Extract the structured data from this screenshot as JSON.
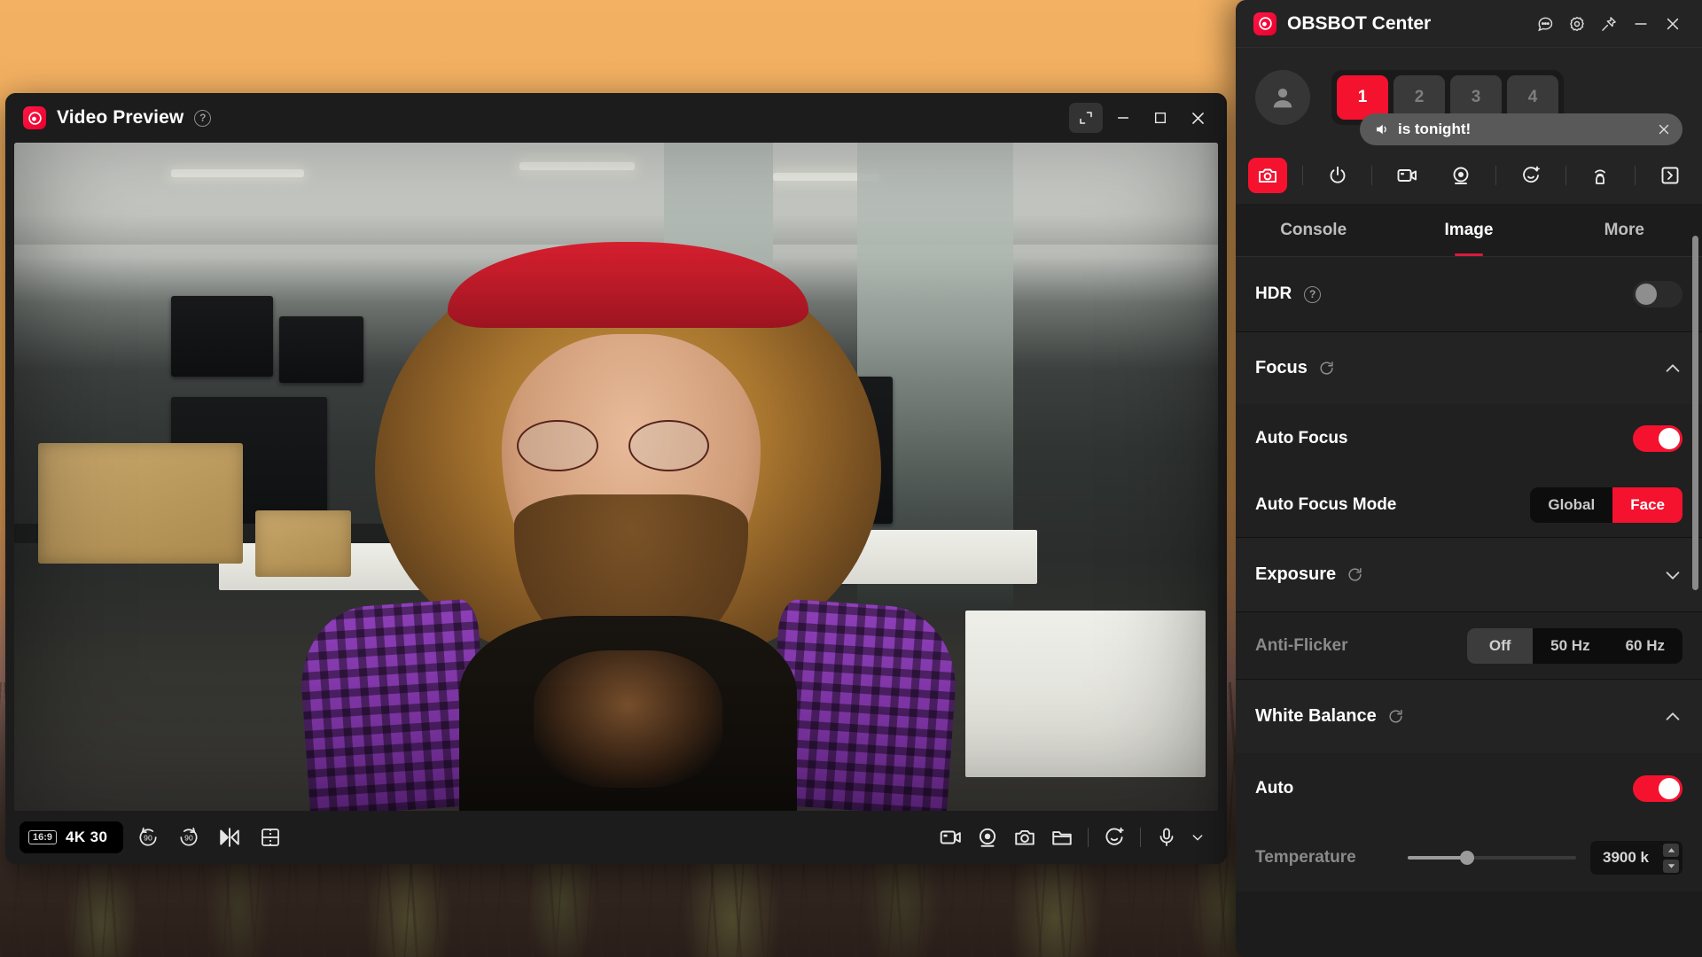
{
  "desktop": {
    "wallpaper_name": "sunset-forest-wallpaper"
  },
  "video_preview": {
    "title": "Video Preview",
    "help_icon": "help-icon",
    "window_buttons": [
      {
        "name": "expand-button",
        "glyph": "expand-icon"
      },
      {
        "name": "minimize-button",
        "glyph": "minimize-icon"
      },
      {
        "name": "maximize-button",
        "glyph": "maximize-icon"
      },
      {
        "name": "close-button",
        "glyph": "close-icon"
      }
    ],
    "controls": {
      "aspect_ratio": "16:9",
      "resolution": "4K 30",
      "left_buttons": [
        {
          "name": "rotate-left-90-button",
          "label": "90"
        },
        {
          "name": "rotate-right-90-button",
          "label": "90"
        },
        {
          "name": "mirror-flip-button",
          "label": ""
        },
        {
          "name": "grid-overlay-button",
          "label": ""
        }
      ],
      "right_buttons": [
        {
          "name": "record-video-button"
        },
        {
          "name": "webcam-button"
        },
        {
          "name": "snapshot-button"
        },
        {
          "name": "open-folder-button"
        },
        {
          "name": "beauty-effects-button"
        },
        {
          "name": "microphone-button"
        },
        {
          "name": "audio-dropdown-button"
        }
      ]
    }
  },
  "obsbot": {
    "title": "OBSBOT Center",
    "titlebar_buttons": [
      {
        "name": "feedback-button",
        "glyph": "chat-icon"
      },
      {
        "name": "settings-button",
        "glyph": "gear-icon"
      },
      {
        "name": "pin-button",
        "glyph": "pin-icon"
      },
      {
        "name": "minimize-button",
        "glyph": "minimize-icon"
      },
      {
        "name": "close-button",
        "glyph": "close-icon"
      }
    ],
    "avatar": "user-avatar-icon",
    "presets": [
      {
        "label": "1",
        "active": true
      },
      {
        "label": "2",
        "active": false
      },
      {
        "label": "3",
        "active": false
      },
      {
        "label": "4",
        "active": false
      }
    ],
    "toast": {
      "icon": "speaker-icon",
      "text": "is tonight!",
      "close": "close-icon"
    },
    "toolbar": [
      {
        "name": "camera-tool",
        "active": true
      },
      {
        "name": "power-tool",
        "active": false
      },
      {
        "name": "video-tool",
        "active": false
      },
      {
        "name": "tracking-tool",
        "active": false
      },
      {
        "name": "beauty-tool",
        "active": false
      },
      {
        "name": "gesture-tool",
        "active": false
      },
      {
        "name": "expand-panel-tool",
        "active": false
      }
    ],
    "tabs": [
      {
        "label": "Console",
        "active": false
      },
      {
        "label": "Image",
        "active": true
      },
      {
        "label": "More",
        "active": false
      }
    ],
    "settings": {
      "hdr": {
        "label": "HDR",
        "help": "help-icon",
        "enabled": false
      },
      "focus_section": {
        "label": "Focus",
        "expanded": true,
        "reset": "reset-icon"
      },
      "auto_focus": {
        "label": "Auto Focus",
        "enabled": true
      },
      "auto_focus_mode": {
        "label": "Auto Focus Mode",
        "options": [
          {
            "label": "Global",
            "selected": false
          },
          {
            "label": "Face",
            "selected": true
          }
        ]
      },
      "exposure_section": {
        "label": "Exposure",
        "expanded": false,
        "reset": "reset-icon"
      },
      "anti_flicker": {
        "label": "Anti-Flicker",
        "options": [
          {
            "label": "Off",
            "selected": true
          },
          {
            "label": "50 Hz",
            "selected": false
          },
          {
            "label": "60 Hz",
            "selected": false
          }
        ]
      },
      "white_balance_section": {
        "label": "White Balance",
        "expanded": true,
        "reset": "reset-icon"
      },
      "wb_auto": {
        "label": "Auto",
        "enabled": true
      },
      "temperature": {
        "label": "Temperature",
        "value": "3900 k",
        "slider_percent": 35
      }
    },
    "colors": {
      "accent_red": "#f5122f",
      "tab_underline": "#d81b3c",
      "panel_bg": "#242424",
      "content_bg": "#1c1c1c",
      "row_bg": "#202020"
    }
  }
}
